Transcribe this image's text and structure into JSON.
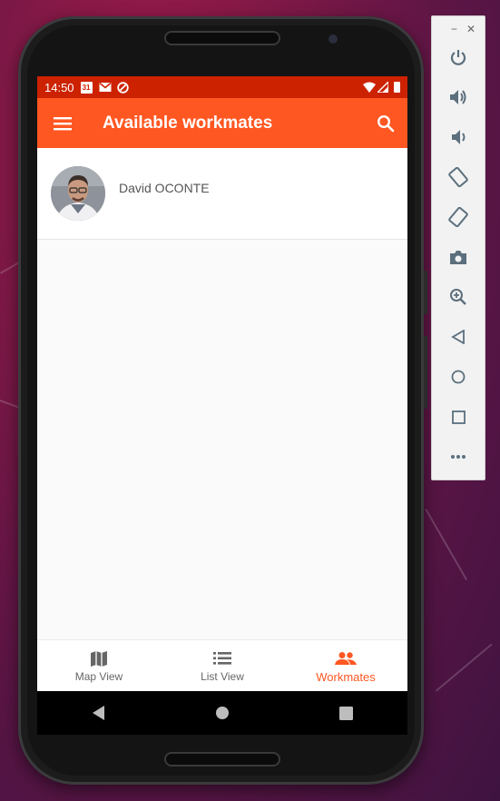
{
  "status_bar": {
    "time": "14:50",
    "calendar_day": "31",
    "left_icons": [
      "calendar-icon",
      "gmail-icon",
      "sync-icon"
    ],
    "right_icons": [
      "wifi-icon",
      "cell-signal-icon",
      "battery-icon"
    ]
  },
  "app_bar": {
    "title": "Available workmates",
    "menu_icon": "hamburger-menu-icon",
    "search_icon": "search-icon"
  },
  "workmates": [
    {
      "name": "David OCONTE",
      "avatar": "profile-photo"
    }
  ],
  "bottom_nav": [
    {
      "label": "Map View",
      "icon": "map-icon",
      "active": false
    },
    {
      "label": "List View",
      "icon": "list-icon",
      "active": false
    },
    {
      "label": "Workmates",
      "icon": "people-icon",
      "active": true
    }
  ],
  "system_nav": [
    "back-icon",
    "home-icon",
    "overview-icon"
  ],
  "emulator_controls": {
    "window_buttons": {
      "minimize": "−",
      "close": "✕"
    },
    "buttons": [
      "power-icon",
      "volume-up-icon",
      "volume-down-icon",
      "rotate-left-icon",
      "rotate-right-icon",
      "camera-icon",
      "zoom-icon",
      "back-icon",
      "home-icon",
      "overview-icon",
      "more-icon"
    ]
  },
  "colors": {
    "primary": "#ff5722",
    "status_bar": "#cc2200",
    "active_nav": "#ff5722"
  }
}
